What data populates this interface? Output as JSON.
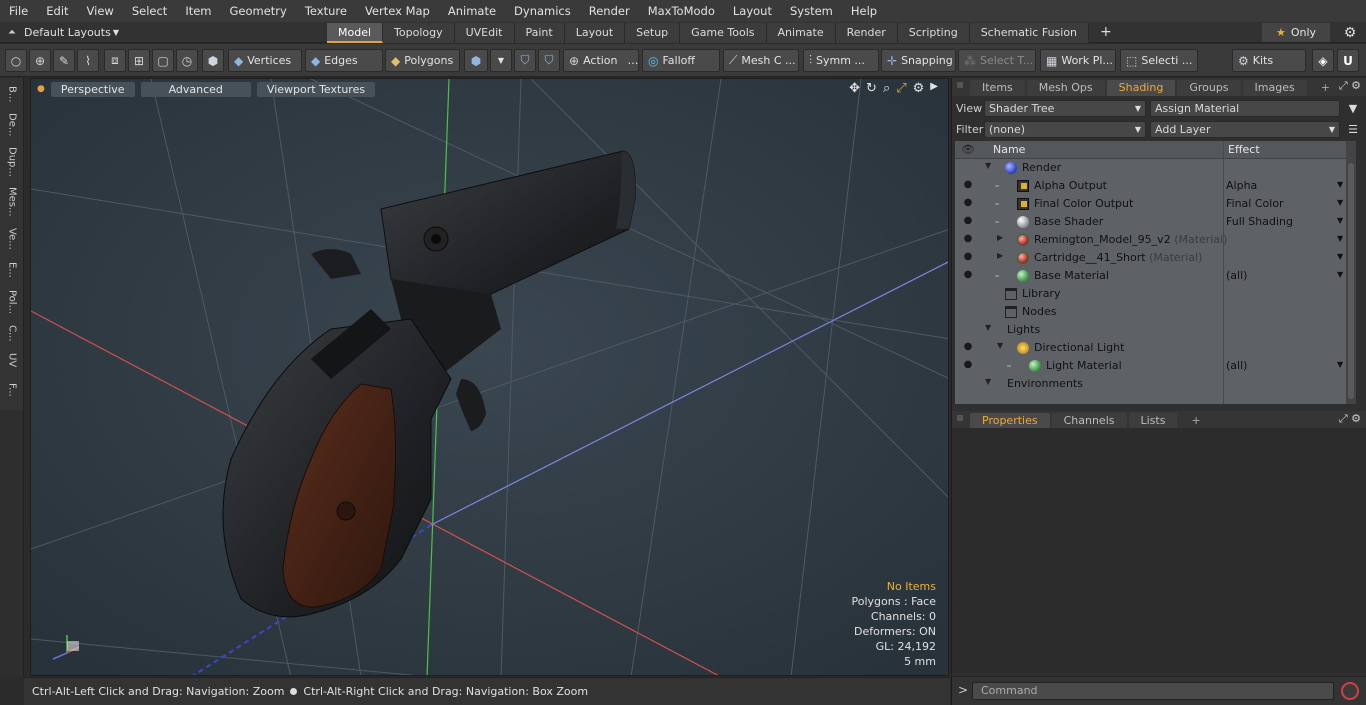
{
  "menu": [
    "File",
    "Edit",
    "View",
    "Select",
    "Item",
    "Geometry",
    "Texture",
    "Vertex Map",
    "Animate",
    "Dynamics",
    "Render",
    "MaxToModo",
    "Layout",
    "System",
    "Help"
  ],
  "layout_selector": "Default Layouts",
  "layout_tabs": [
    "Model",
    "Topology",
    "UVEdit",
    "Paint",
    "Layout",
    "Setup",
    "Game Tools",
    "Animate",
    "Render",
    "Scripting",
    "Schematic Fusion"
  ],
  "active_layout_tab": "Model",
  "only_label": "Only",
  "toolbar": {
    "vertices": "Vertices",
    "edges": "Edges",
    "polygons": "Polygons",
    "action": "Action",
    "falloff": "Falloff",
    "mesh_c": "Mesh C ...",
    "symm": "Symm ...",
    "snapping": "Snapping",
    "select_t": "Select T...",
    "work_pl": "Work Pl...",
    "selecti": "Selecti ...",
    "kits": "Kits"
  },
  "left_tabs": [
    "B...",
    "De...",
    "Dup...",
    "Mes...",
    "Ve...",
    "E...",
    "Pol...",
    "C...",
    "UV",
    "F..."
  ],
  "viewport": {
    "buttons": [
      "Perspective",
      "Advanced",
      "Viewport Textures"
    ],
    "info": {
      "selection": "No Items",
      "polygons": "Polygons : Face",
      "channels": "Channels: 0",
      "deformers": "Deformers: ON",
      "gl": "GL: 24,192",
      "scale": "5 mm"
    }
  },
  "status": {
    "hint1": "Ctrl-Alt-Left Click and Drag: Navigation: Zoom",
    "hint2": "Ctrl-Alt-Right Click and Drag: Navigation: Box Zoom"
  },
  "right_panel": {
    "tabs": [
      "Items",
      "Mesh Ops",
      "Shading",
      "Groups",
      "Images"
    ],
    "active_tab": "Shading",
    "view_label": "View",
    "view_value": "Shader Tree",
    "assign_material": "Assign Material",
    "filter_label": "Filter",
    "filter_value": "(none)",
    "add_layer": "Add Layer",
    "tree_columns": {
      "name": "Name",
      "effect": "Effect"
    },
    "tree_rows": [
      {
        "name": "Render",
        "suffix": "",
        "effect": ""
      },
      {
        "name": "Alpha Output",
        "suffix": "",
        "effect": "Alpha"
      },
      {
        "name": "Final Color Output",
        "suffix": "",
        "effect": "Final Color"
      },
      {
        "name": "Base Shader",
        "suffix": "",
        "effect": "Full Shading"
      },
      {
        "name": "Remington_Model_95_v2",
        "suffix": "(Material)",
        "effect": ""
      },
      {
        "name": "Cartridge__41_Short",
        "suffix": "(Material)",
        "effect": ""
      },
      {
        "name": "Base Material",
        "suffix": "",
        "effect": "(all)"
      },
      {
        "name": "Library",
        "suffix": "",
        "effect": ""
      },
      {
        "name": "Nodes",
        "suffix": "",
        "effect": ""
      },
      {
        "name": "Lights",
        "suffix": "",
        "effect": ""
      },
      {
        "name": "Directional Light",
        "suffix": "",
        "effect": ""
      },
      {
        "name": "Light Material",
        "suffix": "",
        "effect": "(all)"
      },
      {
        "name": "Environments",
        "suffix": "",
        "effect": ""
      }
    ],
    "lower_tabs": [
      "Properties",
      "Channels",
      "Lists"
    ],
    "lower_active": "Properties",
    "command_placeholder": "Command"
  },
  "colors": {
    "accent": "#e4a33a",
    "viewport_bg": "#2f3b44",
    "grip_wood": "#4a2518"
  }
}
